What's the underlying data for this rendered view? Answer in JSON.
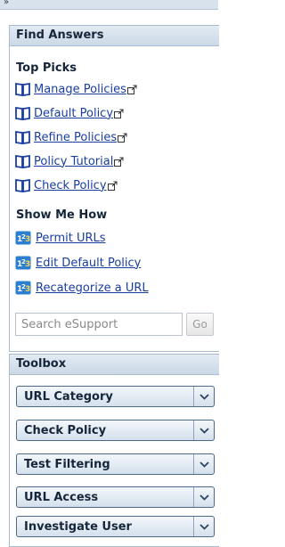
{
  "topbar": {
    "collapse_glyph": "»"
  },
  "find_answers": {
    "title": "Find Answers",
    "top_picks": {
      "title": "Top Picks",
      "items": [
        {
          "label": "Manage Policies"
        },
        {
          "label": "Default Policy"
        },
        {
          "label": "Refine Policies"
        },
        {
          "label": "Policy Tutorial"
        },
        {
          "label": "Check Policy"
        }
      ]
    },
    "show_me_how": {
      "title": "Show Me How",
      "items": [
        {
          "label": "Permit URLs"
        },
        {
          "label": "Edit Default Policy"
        },
        {
          "label": "Recategorize a URL"
        }
      ]
    },
    "search": {
      "placeholder": "Search eSupport",
      "value": "",
      "go_label": "Go"
    }
  },
  "toolbox": {
    "title": "Toolbox",
    "items": [
      {
        "label": "URL Category"
      },
      {
        "label": "Check Policy"
      },
      {
        "label": "Test Filtering"
      },
      {
        "label": "URL Access"
      },
      {
        "label": "Investigate User"
      }
    ]
  },
  "colors": {
    "link": "#1a3ea0",
    "header_text": "#15263a",
    "border": "#a9bccf",
    "book_icon": "#1a3ea0",
    "help_icon": "#2a7fd0"
  }
}
